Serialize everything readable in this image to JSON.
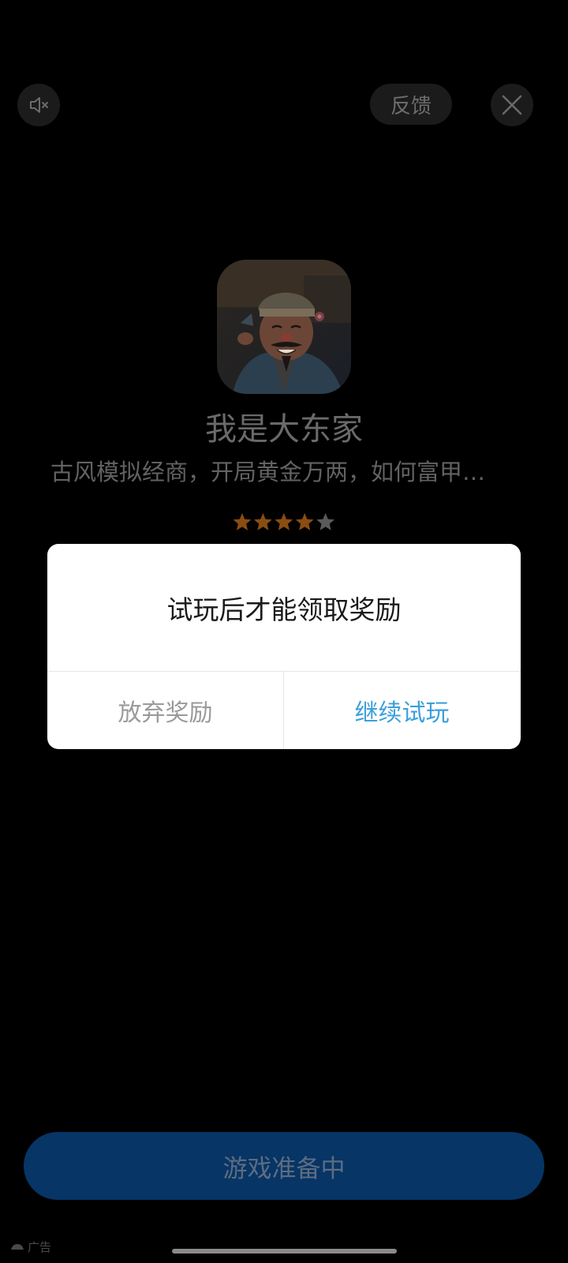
{
  "top_bar": {
    "mute_icon": "speaker-muted-icon",
    "feedback_label": "反馈",
    "close_icon": "close-icon"
  },
  "app": {
    "name": "我是大东家",
    "description": "古风模拟经商，开局黄金万两，如何富甲…",
    "rating_stars": 4,
    "rating_max": 5
  },
  "dialog": {
    "message": "试玩后才能领取奖励",
    "give_up_label": "放弃奖励",
    "continue_label": "继续试玩"
  },
  "cta": {
    "label": "游戏准备中"
  },
  "ad": {
    "label": "广告"
  },
  "colors": {
    "accent": "#3b9fdc",
    "cta_bg": "#063566",
    "star_active": "#8a4d12",
    "star_inactive": "#5a5a5a"
  }
}
